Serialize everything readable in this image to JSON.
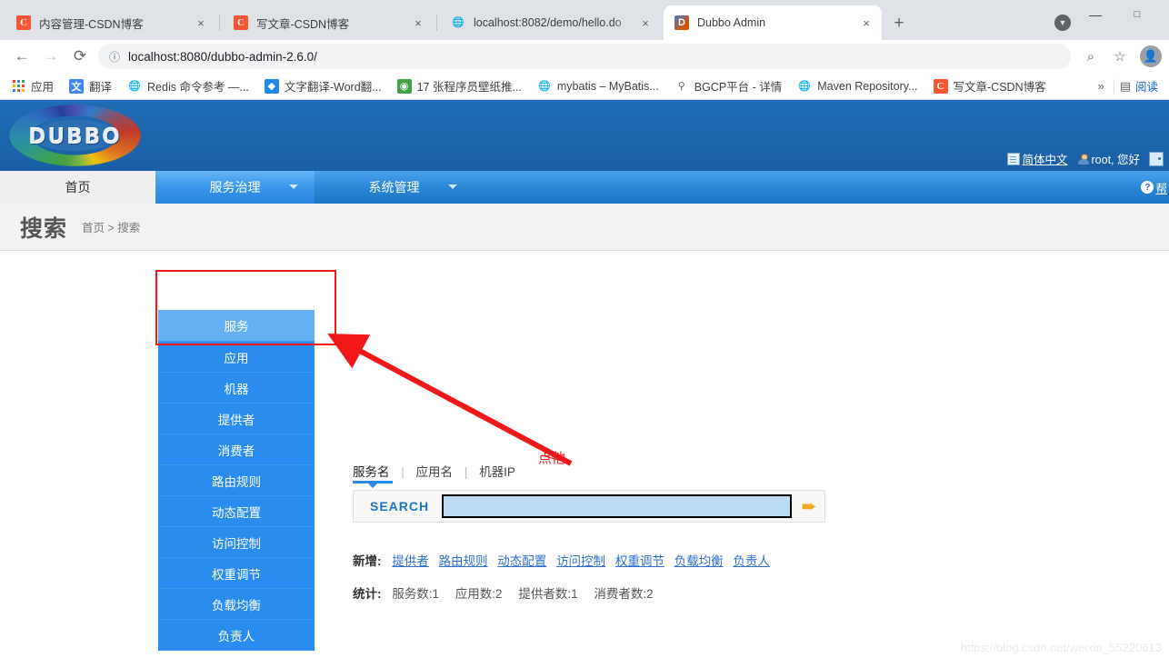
{
  "browser": {
    "tabs": [
      {
        "title": "内容管理-CSDN博客",
        "favicon": "csdn-icon",
        "active": false,
        "close": "×"
      },
      {
        "title": "写文章-CSDN博客",
        "favicon": "csdn-icon",
        "active": false,
        "close": "×"
      },
      {
        "title": "localhost:8082/demo/hello.do",
        "favicon": "globe-icon",
        "active": false,
        "close": "×"
      },
      {
        "title": "Dubbo Admin",
        "favicon": "dubbo-icon",
        "active": true,
        "close": "×"
      }
    ],
    "new_tab_label": "+",
    "window_controls": {
      "minimize": "—",
      "maximize": "□"
    },
    "toolbar": {
      "back": "←",
      "forward": "→",
      "reload": "⟳",
      "info_icon": "ⓘ",
      "url": "localhost:8080/dubbo-admin-2.6.0/",
      "url_host": "localhost:8080",
      "url_path": "/dubbo-admin-2.6.0/",
      "zoom_icon": "⌕",
      "star_icon": "☆",
      "profile_icon": "●"
    },
    "bookmarks": [
      {
        "label": "应用",
        "icon": "apps-grid-icon"
      },
      {
        "label": "翻译",
        "icon": "google-translate-icon"
      },
      {
        "label": "Redis 命令参考 —...",
        "icon": "globe-icon"
      },
      {
        "label": "文字翻译-Word翻...",
        "icon": "blue-diamond-icon"
      },
      {
        "label": "17 张程序员壁纸推...",
        "icon": "green-circle-icon"
      },
      {
        "label": "mybatis – MyBatis...",
        "icon": "globe-icon"
      },
      {
        "label": "BGCP平台 - 详情",
        "icon": "dot-icon"
      },
      {
        "label": "Maven Repository...",
        "icon": "globe-icon"
      },
      {
        "label": "写文章-CSDN博客",
        "icon": "csdn-icon"
      }
    ],
    "bookmarks_overflow": "»",
    "reader_mode": "阅读"
  },
  "app": {
    "logo_text": "DUBBO",
    "user_actions": [
      {
        "label": "简体中文",
        "icon": "language-doc-icon"
      },
      {
        "label": "root, 您好",
        "icon": "user-person-icon"
      },
      {
        "label": "",
        "icon": "logout-door-icon"
      }
    ],
    "nav": [
      {
        "label": "首页",
        "active": false,
        "has_caret": false
      },
      {
        "label": "服务治理",
        "active": true,
        "has_caret": true
      },
      {
        "label": "系统管理",
        "active": false,
        "has_caret": true
      }
    ],
    "help": {
      "label": "帮",
      "icon": "question-circle-icon"
    },
    "page_header": {
      "title": "搜索",
      "breadcrumb": "首页 > 搜索"
    },
    "dropdown": {
      "items": [
        {
          "label": "服务",
          "highlighted": true
        },
        {
          "label": "应用",
          "highlighted": false
        },
        {
          "label": "机器",
          "highlighted": false
        },
        {
          "label": "提供者",
          "highlighted": false
        },
        {
          "label": "消费者",
          "highlighted": false
        },
        {
          "label": "路由规则",
          "highlighted": false
        },
        {
          "label": "动态配置",
          "highlighted": false
        },
        {
          "label": "访问控制",
          "highlighted": false
        },
        {
          "label": "权重调节",
          "highlighted": false
        },
        {
          "label": "负载均衡",
          "highlighted": false
        },
        {
          "label": "负责人",
          "highlighted": false
        }
      ]
    },
    "search": {
      "tabs": [
        {
          "label": "服务名",
          "selected": true
        },
        {
          "label": "应用名",
          "selected": false
        },
        {
          "label": "机器IP",
          "selected": false
        }
      ],
      "separator": "|",
      "button_label": "SEARCH",
      "input_value": "",
      "input_placeholder": "",
      "go_icon": "➨"
    },
    "new_section": {
      "label": "新增:",
      "links": [
        "提供者",
        "路由规则",
        "动态配置",
        "访问控制",
        "权重调节",
        "负载均衡",
        "负责人"
      ]
    },
    "stats_section": {
      "label": "统计:",
      "items": [
        "服务数:1",
        "应用数:2",
        "提供者数:1",
        "消费者数:2"
      ]
    },
    "annotation": {
      "text": "点他",
      "color": "#f01818"
    },
    "watermark": "https://blog.csdn.net/weixin_55220613"
  },
  "colors": {
    "dubbo_blue": "#1b64ad",
    "nav_blue": "#2b86d6",
    "dropdown_blue": "#2a8cee",
    "highlight_red": "#f01818",
    "link_blue": "#2f6fd0"
  }
}
